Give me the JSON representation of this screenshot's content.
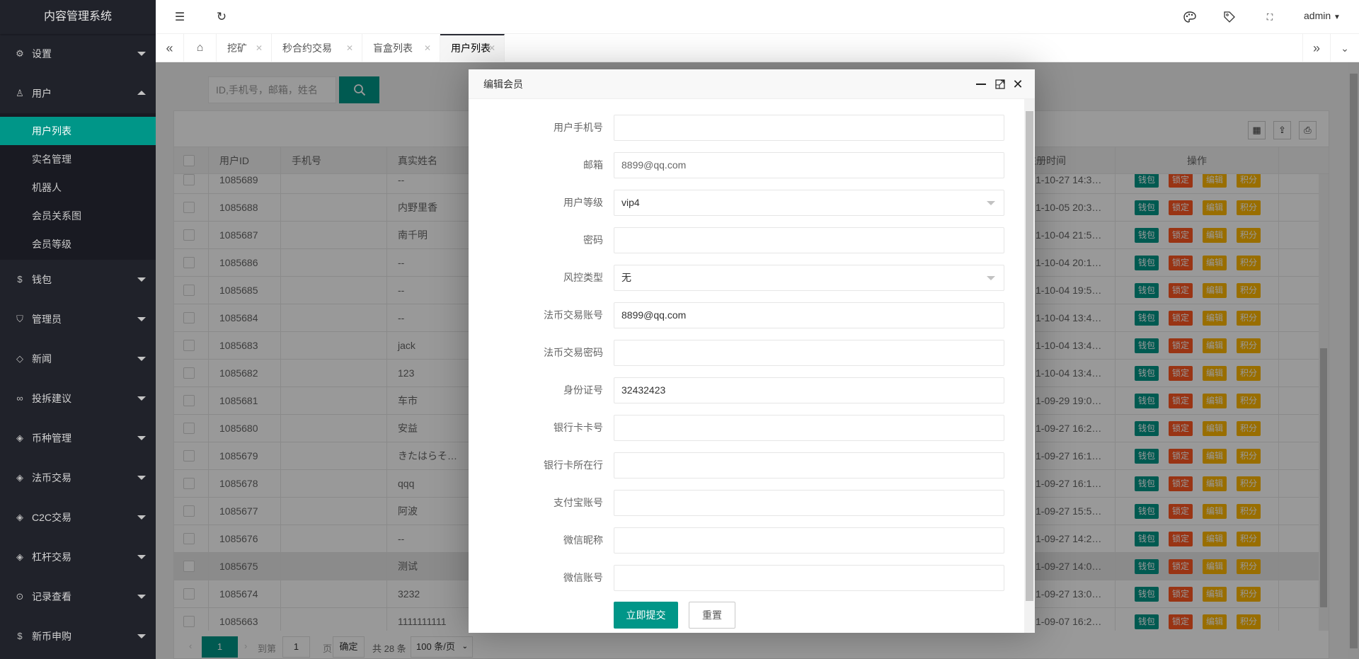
{
  "app": {
    "title": "内容管理系统"
  },
  "colors": {
    "accent": "#009688",
    "sidebar": "#20222a",
    "danger": "#FF5722",
    "warn": "#FFB800"
  },
  "sidebar": {
    "items": [
      {
        "label": "设置",
        "icon": "gear-icon",
        "expanded": false
      },
      {
        "label": "用户",
        "icon": "user-icon",
        "expanded": true
      },
      {
        "label": "钱包",
        "icon": "dollar-icon"
      },
      {
        "label": "管理员",
        "icon": "shield-icon"
      },
      {
        "label": "新闻",
        "icon": "tag-icon"
      },
      {
        "label": "投拆建议",
        "icon": "link-icon"
      },
      {
        "label": "币种管理",
        "icon": "diamond-icon"
      },
      {
        "label": "法币交易",
        "icon": "diamond-icon"
      },
      {
        "label": "C2C交易",
        "icon": "diamond-icon"
      },
      {
        "label": "杠杆交易",
        "icon": "diamond-icon"
      },
      {
        "label": "记录查看",
        "icon": "log-icon"
      },
      {
        "label": "新币申购",
        "icon": "dollar-icon"
      }
    ],
    "submenu": [
      "用户列表",
      "实名管理",
      "机器人",
      "会员关系图",
      "会员等级"
    ],
    "active_sub": "用户列表"
  },
  "header": {
    "user": "admin"
  },
  "tabs": [
    {
      "label": "挖矿"
    },
    {
      "label": "秒合约交易"
    },
    {
      "label": "盲盒列表"
    },
    {
      "label": "用户列表",
      "active": true
    }
  ],
  "search": {
    "placeholder": "ID,手机号，邮箱，姓名"
  },
  "table": {
    "columns": [
      "用户ID",
      "手机号",
      "真实姓名",
      "注册时间",
      "操作"
    ],
    "actions": [
      "钱包",
      "锁定",
      "编辑",
      "积分"
    ],
    "rows": [
      {
        "id": "1085689",
        "phone": "",
        "name": "--",
        "time": "1-10-27 14:3…"
      },
      {
        "id": "1085688",
        "phone": "",
        "name": "内野里香",
        "time": "1-10-05 20:3…"
      },
      {
        "id": "1085687",
        "phone": "",
        "name": "南千明",
        "time": "1-10-04 21:5…"
      },
      {
        "id": "1085686",
        "phone": "",
        "name": "--",
        "time": "1-10-04 20:1…"
      },
      {
        "id": "1085685",
        "phone": "",
        "name": "--",
        "time": "1-10-04 19:5…"
      },
      {
        "id": "1085684",
        "phone": "",
        "name": "--",
        "time": "1-10-04 13:4…"
      },
      {
        "id": "1085683",
        "phone": "",
        "name": "jack",
        "time": "1-10-04 13:4…"
      },
      {
        "id": "1085682",
        "phone": "",
        "name": "123",
        "time": "1-10-04 13:4…"
      },
      {
        "id": "1085681",
        "phone": "",
        "name": "车市",
        "time": "1-09-29 19:0…"
      },
      {
        "id": "1085680",
        "phone": "",
        "name": "安益",
        "time": "1-09-27 16:2…"
      },
      {
        "id": "1085679",
        "phone": "",
        "name": "きたはらそ…",
        "time": "1-09-27 16:1…"
      },
      {
        "id": "1085678",
        "phone": "",
        "name": "qqq",
        "time": "1-09-27 16:1…"
      },
      {
        "id": "1085677",
        "phone": "",
        "name": "阿波",
        "time": "1-09-27 15:5…"
      },
      {
        "id": "1085676",
        "phone": "",
        "name": "--",
        "time": "1-09-27 14:2…"
      },
      {
        "id": "1085675",
        "phone": "",
        "name": "测试",
        "time": "1-09-27 14:0…",
        "highlight": true
      },
      {
        "id": "1085674",
        "phone": "",
        "name": "3232",
        "time": "1-09-27 13:0…"
      },
      {
        "id": "1085663",
        "phone": "",
        "name": "1111111111",
        "time": "1-09-07 16:2…"
      }
    ]
  },
  "pager": {
    "current": "1",
    "goto_label": "到第",
    "goto_value": "1",
    "page_label": "页",
    "confirm": "确定",
    "total": "共 28 条",
    "per_page": "100 条/页"
  },
  "dialog": {
    "title": "编辑会员",
    "fields": [
      {
        "label": "用户手机号",
        "value": ""
      },
      {
        "label": "邮箱",
        "value": "8899@qq.com",
        "dim": true
      },
      {
        "label": "用户等级",
        "value": "vip4",
        "select": true
      },
      {
        "label": "密码",
        "value": ""
      },
      {
        "label": "风控类型",
        "value": "无",
        "select": true
      },
      {
        "label": "法币交易账号",
        "value": "8899@qq.com"
      },
      {
        "label": "法币交易密码",
        "value": ""
      },
      {
        "label": "身份证号",
        "value": "32432423"
      },
      {
        "label": "银行卡卡号",
        "value": ""
      },
      {
        "label": "银行卡所在行",
        "value": ""
      },
      {
        "label": "支付宝账号",
        "value": ""
      },
      {
        "label": "微信昵称",
        "value": ""
      },
      {
        "label": "微信账号",
        "value": ""
      }
    ],
    "submit": "立即提交",
    "reset": "重置"
  }
}
